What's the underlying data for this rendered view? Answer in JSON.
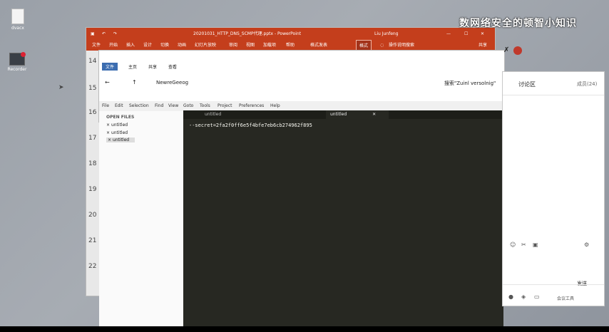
{
  "desktop": {
    "icons": [
      {
        "label": "dvacx"
      },
      {
        "label": "Recorder"
      }
    ]
  },
  "watermark": {
    "text": "数网络安全的顿智小知识"
  },
  "ppt": {
    "title": "20201031_HTTP_DNS_SCMP代理.pptx - PowerPoint",
    "user": "Liu Junfeng",
    "share_label": "共享",
    "ribbon": [
      "文件",
      "开始",
      "插入",
      "设计",
      "切换",
      "动画",
      "幻灯片放映",
      "审阅",
      "视图",
      "加载项",
      "帮助",
      "格式发表",
      "格式"
    ],
    "tell_me": "操作说明搜索",
    "rail_numbers": [
      "14",
      "15",
      "16",
      "17",
      "18",
      "19",
      "20",
      "21",
      "22"
    ]
  },
  "explorer": {
    "tabs": [
      "文件",
      "主页",
      "共享",
      "查看"
    ],
    "path": "NewreGeeog",
    "search": "搜索\"Zuinl versolnig\""
  },
  "sublime": {
    "menu": [
      "File",
      "Edit",
      "Selection",
      "Find",
      "View",
      "Goto",
      "Tools",
      "Project",
      "Preferences",
      "Help"
    ],
    "sidebar_header": "OPEN FILES",
    "open_files": [
      "untitled",
      "untitled",
      "untitled"
    ],
    "tabs": [
      "untitled",
      "untitled"
    ],
    "code_line": "--secret=2fa2f0ff6e5f4bfe7eb6cb274962f895"
  },
  "chat": {
    "title": "讨论区",
    "members": "成员(24)",
    "send_label": "发送",
    "footer": "会议工具"
  }
}
